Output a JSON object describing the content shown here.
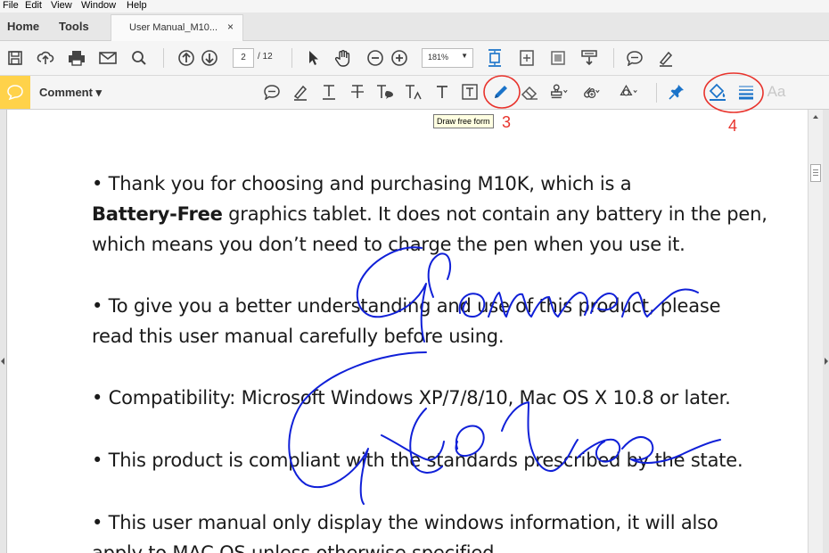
{
  "menu": [
    "File",
    "Edit",
    "View",
    "Window",
    "Help"
  ],
  "nav": {
    "home": "Home",
    "tools": "Tools"
  },
  "tab": {
    "title": "User Manual_M10...",
    "close": "×"
  },
  "toolbar": {
    "page_current": "2",
    "page_total": "/ 12",
    "zoom": "181%"
  },
  "comment_bar": {
    "label": "Comment ▾"
  },
  "tooltip": "Draw free form",
  "callouts": {
    "three": "3",
    "four": "4"
  },
  "font_size_icon": "Aa",
  "document": {
    "p1_bullet": "• Thank you for choosing and purchasing M10K, which is a",
    "p1_bold": "Battery-Free",
    "p1_rest": " graphics tablet. It does not contain any battery in the pen,",
    "p1_line3": "which means you don’t need to charge the pen when you use it.",
    "p2_line1": "• To give you a better understanding and use of this product, please",
    "p2_line2": "read this user manual carefully before using.",
    "p3": "• Compatibility: Microsoft Windows XP/7/8/10, Mac OS X 10.8 or later.",
    "p4": "• This product is compliant with the standards prescribed by the state.",
    "p5_line1": "• This user manual only display the windows information, it will also",
    "p5_line2": "apply to MAC OS unless otherwise specified."
  },
  "colors": {
    "ink": "#1020d8",
    "callout": "#e8332c",
    "accent": "#1a73c9",
    "comment_badge": "#ffd24a"
  }
}
